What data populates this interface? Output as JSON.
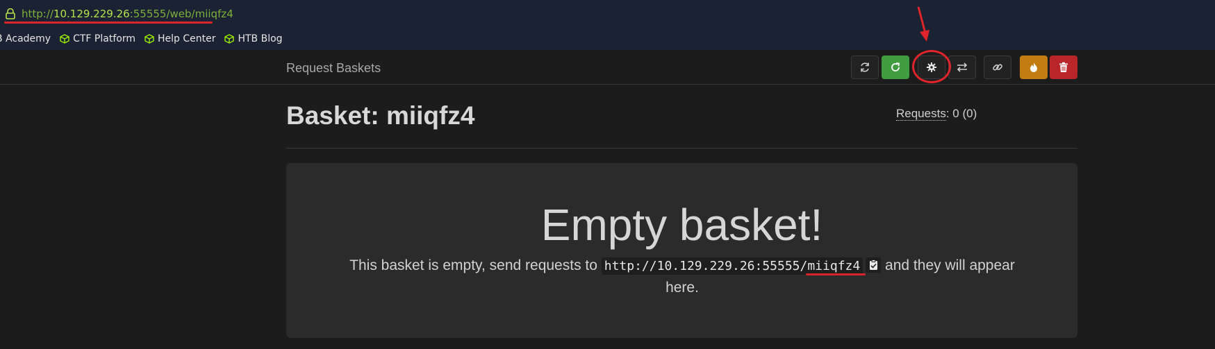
{
  "browser": {
    "url_prefix": "http://",
    "url_host": "10.129.229.26",
    "url_suffix": ":55555/web/miiqfz4",
    "bookmarks": [
      {
        "label": "B Academy"
      },
      {
        "label": "CTF Platform"
      },
      {
        "label": "Help Center"
      },
      {
        "label": "HTB Blog"
      }
    ]
  },
  "navbar": {
    "brand": "Request Baskets",
    "buttons": [
      {
        "name": "refresh-button",
        "icon": "refresh-icon"
      },
      {
        "name": "auto-refresh-button",
        "icon": "reload-icon"
      },
      {
        "name": "settings-button",
        "icon": "gear-icon"
      },
      {
        "name": "responses-button",
        "icon": "transfer-icon"
      },
      {
        "name": "link-button",
        "icon": "link-icon"
      },
      {
        "name": "destroy-button",
        "icon": "fire-icon"
      },
      {
        "name": "delete-button",
        "icon": "trash-icon"
      }
    ]
  },
  "basket": {
    "title": "Basket: miiqfz4",
    "requests_label": "Requests",
    "requests_count": ": 0 (0)"
  },
  "panel": {
    "heading": "Empty basket!",
    "text_before": "This basket is empty, send requests to ",
    "url": "http://10.129.229.26:55555/miiqfz4",
    "text_after": " and they will appear here."
  },
  "colors": {
    "url_green": "#7fb13a",
    "annotation_red": "#e0242b",
    "btn_green": "#3f9d3f",
    "btn_orange": "#c37c12",
    "btn_red": "#b8262a"
  }
}
